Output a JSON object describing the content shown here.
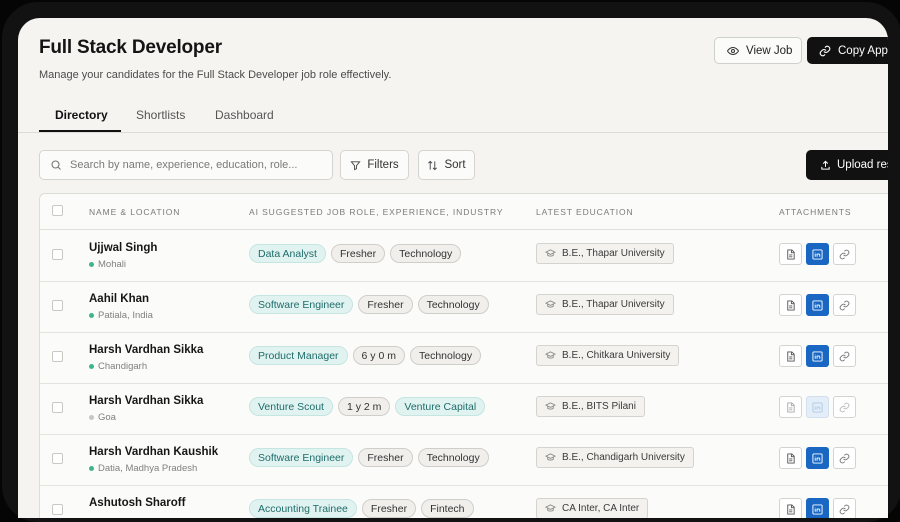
{
  "header": {
    "title": "Full Stack Developer",
    "subtitle": "Manage your candidates for the Full Stack Developer job role effectively.",
    "view_job_label": "View Job",
    "copy_app_label": "Copy Appl"
  },
  "tabs": [
    {
      "label": "Directory",
      "active": true
    },
    {
      "label": "Shortlists",
      "active": false
    },
    {
      "label": "Dashboard",
      "active": false
    }
  ],
  "toolbar": {
    "search_placeholder": "Search by name, experience, education, role...",
    "filters_label": "Filters",
    "sort_label": "Sort",
    "upload_label": "Upload res"
  },
  "table": {
    "columns": [
      "NAME & LOCATION",
      "AI SUGGESTED JOB ROLE, EXPERIENCE, INDUSTRY",
      "LATEST EDUCATION",
      "ATTACHMENTS"
    ],
    "rows": [
      {
        "name": "Ujjwal Singh",
        "location": "Mohali",
        "role": "Data Analyst",
        "experience": "Fresher",
        "industry": "Technology",
        "education": "B.E., Thapar University",
        "resume": true,
        "linkedin": true,
        "link": true
      },
      {
        "name": "Aahil Khan",
        "location": "Patiala, India",
        "role": "Software Engineer",
        "experience": "Fresher",
        "industry": "Technology",
        "education": "B.E., Thapar University",
        "resume": true,
        "linkedin": true,
        "link": true
      },
      {
        "name": "Harsh Vardhan Sikka",
        "location": "Chandigarh",
        "role": "Product Manager",
        "experience": "6 y 0 m",
        "industry": "Technology",
        "education": "B.E., Chitkara University",
        "resume": true,
        "linkedin": true,
        "link": true
      },
      {
        "name": "Harsh Vardhan Sikka",
        "location": "Goa",
        "role": "Venture Scout",
        "experience": "1 y 2 m",
        "industry": "Venture Capital",
        "education": "B.E., BITS Pilani",
        "resume": false,
        "linkedin": false,
        "link": false
      },
      {
        "name": "Harsh Vardhan Kaushik",
        "location": "Datia, Madhya Pradesh",
        "role": "Software Engineer",
        "experience": "Fresher",
        "industry": "Technology",
        "education": "B.E., Chandigarh University",
        "resume": true,
        "linkedin": true,
        "link": true
      },
      {
        "name": "Ashutosh Sharoff",
        "location": "",
        "role": "Accounting Trainee",
        "experience": "Fresher",
        "industry": "Fintech",
        "education": "CA Inter, CA Inter",
        "resume": true,
        "linkedin": true,
        "link": true
      }
    ]
  },
  "colors": {
    "accent_dark": "#111111",
    "role_chip_bg": "#e1f3f1",
    "role_chip_text": "#1e6c6a",
    "linkedin_blue": "#1967c2",
    "location_dot": "#3fb58f"
  }
}
